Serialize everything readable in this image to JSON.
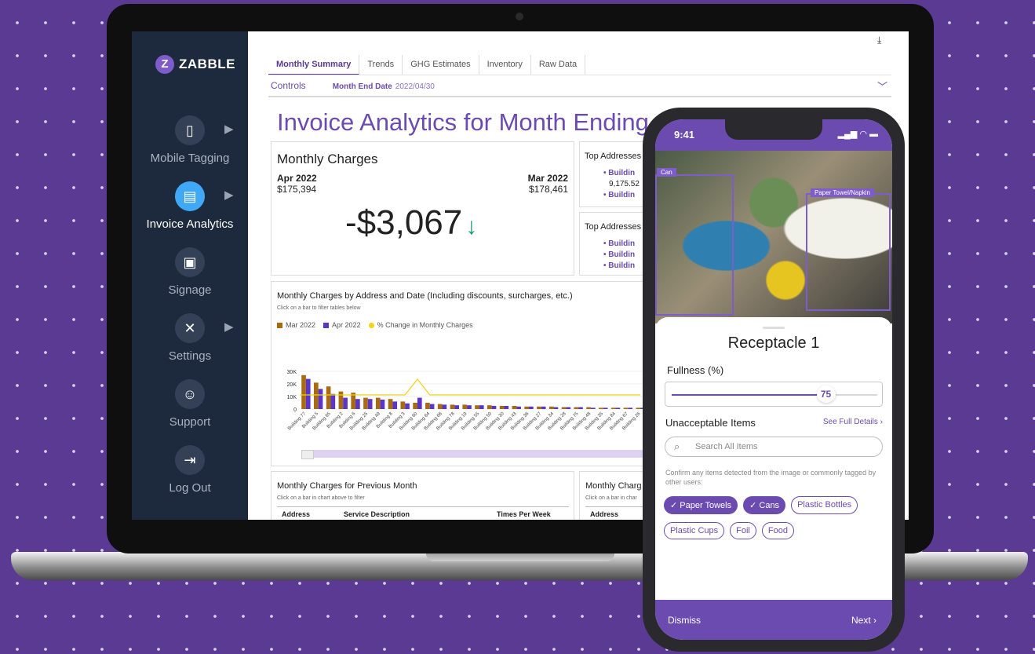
{
  "sidebar": {
    "logo_mark": "Z",
    "logo_text": "ZABBLE",
    "items": [
      {
        "label": "Mobile Tagging",
        "icon": "▯",
        "active": false,
        "arrow": "▶"
      },
      {
        "label": "Invoice Analytics",
        "icon": "▤",
        "active": true,
        "arrow": "▶"
      },
      {
        "label": "Signage",
        "icon": "▣",
        "active": false
      },
      {
        "label": "Settings",
        "icon": "✕",
        "active": false,
        "arrow": "▶"
      },
      {
        "label": "Support",
        "icon": "☺",
        "active": false
      },
      {
        "label": "Log Out",
        "icon": "⇥",
        "active": false
      }
    ]
  },
  "tabs": [
    "Monthly Summary",
    "Trends",
    "GHG Estimates",
    "Inventory",
    "Raw Data"
  ],
  "controls": {
    "label": "Controls",
    "month_end_label": "Month End Date",
    "month_end_value": "2022/04/30"
  },
  "page_title": "Invoice Analytics for Month Ending 20",
  "monthly_charges": {
    "title": "Monthly Charges",
    "current_label": "Apr 2022",
    "current_value": "$175,394",
    "previous_label": "Mar 2022",
    "previous_value": "$178,461",
    "change": "-$3,067",
    "change_arrow": "↓"
  },
  "top_addresses": {
    "title1": "Top Addresses",
    "lines1": [
      "• Buildin",
      "9,175.52",
      "• Buildin"
    ],
    "title2": "Top Addresses",
    "lines2": [
      "• Buildin",
      "• Buildin",
      "• Buildin"
    ]
  },
  "chart_section": {
    "title": "Monthly Charges by Address and Date (Including discounts, surcharges, etc.)",
    "subtitle": "Click on a bar to filter tables below"
  },
  "chart_data": {
    "type": "bar",
    "categories": [
      "Building 77",
      "Building 5",
      "Building 65",
      "Building 2",
      "Building 6",
      "Building 25",
      "Building 49",
      "Building 8",
      "Building 3",
      "Building 60",
      "Building 64",
      "Building 66",
      "Building 78",
      "Building 19",
      "Building 55",
      "Building 59",
      "Building 30",
      "Building 43",
      "Building 36",
      "Building 27",
      "Building 34",
      "Building 28",
      "Building 75",
      "Building 48",
      "Building 35",
      "Building 84",
      "Building 67",
      "Building 26"
    ],
    "series": [
      {
        "name": "Mar 2022",
        "color": "#a86b12",
        "values": [
          27000,
          21000,
          18000,
          14000,
          13000,
          9000,
          9000,
          8000,
          6000,
          5000,
          5000,
          4000,
          3500,
          3500,
          3000,
          3000,
          2500,
          2500,
          2000,
          2000,
          2000,
          1500,
          1500,
          1500,
          1000,
          1000,
          1000,
          1000
        ]
      },
      {
        "name": "Apr 2022",
        "color": "#5a35c8",
        "values": [
          24000,
          16000,
          12000,
          9000,
          8000,
          8000,
          7500,
          6000,
          4500,
          9000,
          4000,
          3500,
          3000,
          3000,
          3000,
          2500,
          2500,
          2000,
          2000,
          2000,
          1500,
          1500,
          1500,
          1000,
          1000,
          1000,
          1000,
          1000
        ]
      },
      {
        "name": "% Change in Monthly Charges",
        "color": "#f2d318",
        "type": "line"
      }
    ],
    "ylim": [
      0,
      30000
    ],
    "ytick_labels": [
      "0",
      "10K",
      "20K",
      "30K"
    ],
    "legend": "top-left"
  },
  "previous_month": {
    "title": "Monthly Charges for Previous Month",
    "subtitle": "Click on a bar in chart above to filter",
    "columns": [
      "Address",
      "Service Description",
      "Times Per Week"
    ],
    "title2": "Monthly Charg",
    "subtitle2": "Click on a bar in char",
    "column2": "Address"
  },
  "phone": {
    "time": "9:41",
    "status_icons": "▂▄▆ ◠ ▬",
    "detections": [
      {
        "label": "Can"
      },
      {
        "label": "Paper Towel/Napkin"
      }
    ],
    "receptacle_title": "Receptacle 1",
    "fullness_label": "Fullness (%)",
    "fullness_value": 75,
    "fullness_display": "75",
    "unacceptable_label": "Unacceptable Items",
    "see_full_details": "See Full Details ›",
    "search_placeholder": "Search All Items",
    "confirm_text": "Confirm any items detected from the image or commonly tagged by other users:",
    "chips": [
      {
        "label": "✓ Paper Towels",
        "selected": true
      },
      {
        "label": "✓ Cans",
        "selected": true
      },
      {
        "label": "Plastic Bottles",
        "selected": false
      },
      {
        "label": "Plastic Cups",
        "selected": false
      },
      {
        "label": "Foil",
        "selected": false
      },
      {
        "label": "Food",
        "selected": false
      }
    ],
    "dismiss": "Dismiss",
    "next": "Next ›"
  },
  "colors": {
    "accent": "#6b4bb0",
    "sidebar": "#1d2a3d",
    "active_icon": "#3fa9f5",
    "down_arrow": "#1a9b6c"
  }
}
